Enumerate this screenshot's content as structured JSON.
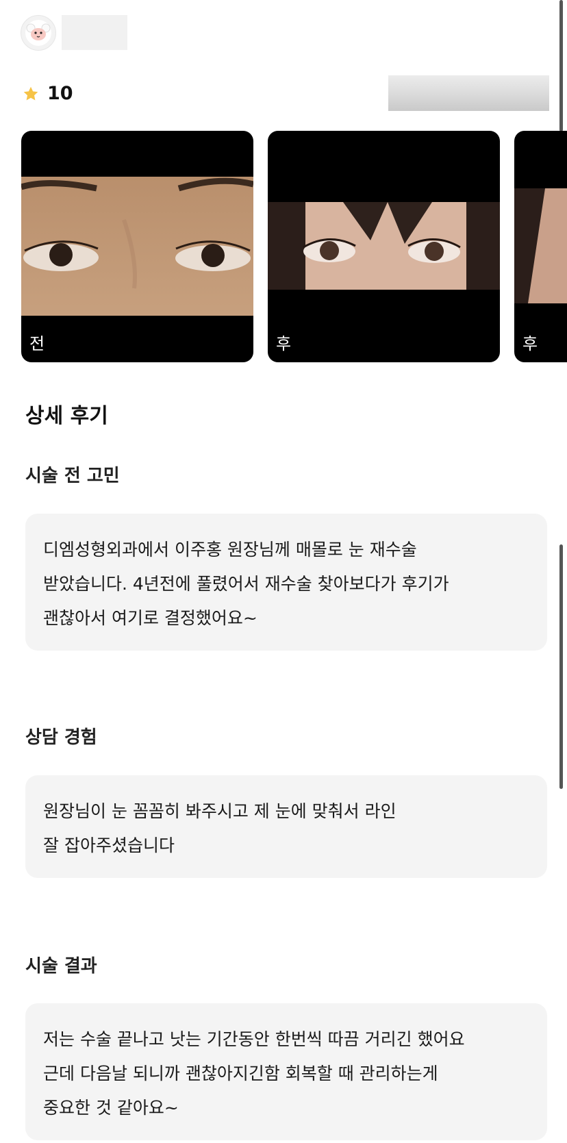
{
  "author": {
    "avatar_icon": "sheep-avatar-icon"
  },
  "rating": {
    "icon": "star-icon",
    "value": "10",
    "star_color": "#f6c347"
  },
  "gallery": [
    {
      "label": "전",
      "image": "before-eyes-photo"
    },
    {
      "label": "후",
      "image": "after-eyes-photo"
    },
    {
      "label": "후",
      "image": "after-eyes-photo-2"
    }
  ],
  "detail": {
    "title": "상세 후기",
    "sections": [
      {
        "heading": "시술 전 고민",
        "lines": [
          "디엠성형외과에서 이주홍 원장님께 매몰로 눈 재수술",
          "받았습니다. 4년전에 풀렸어서 재수술 찾아보다가 후기가",
          "괜찮아서 여기로 결정했어요~"
        ]
      },
      {
        "heading": "상담 경험",
        "lines": [
          "원장님이 눈 꼼꼼히 봐주시고 제 눈에 맞춰서 라인",
          "잘 잡아주셨습니다"
        ]
      },
      {
        "heading": "시술 결과",
        "lines": [
          "저는 수술 끝나고 낫는 기간동안 한번씩 따끔 거리긴 했어요",
          "근데 다음날 되니까 괜찮아지긴함 회복할 때 관리하는게",
          "중요한 것 같아요~"
        ]
      }
    ]
  }
}
